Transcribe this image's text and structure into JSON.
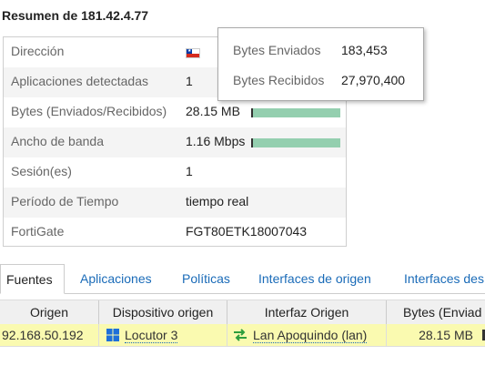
{
  "title": "Resumen de 181.42.4.77",
  "summary": {
    "rows": [
      {
        "label": "Dirección",
        "value": ""
      },
      {
        "label": "Aplicaciones detectadas",
        "value": "1"
      },
      {
        "label": "Bytes (Enviados/Recibidos)",
        "value": "28.15 MB"
      },
      {
        "label": "Ancho de banda",
        "value": "1.16 Mbps"
      },
      {
        "label": "Sesión(es)",
        "value": "1"
      },
      {
        "label": "Período de Tiempo",
        "value": "tiempo real"
      },
      {
        "label": "FortiGate",
        "value": "FGT80ETK18007043"
      }
    ],
    "direction_flag": "chile-flag-icon",
    "bytes_bar_fraction": 1.0,
    "bandwidth_bar_fraction": 1.0
  },
  "tooltip": {
    "sent_label": "Bytes Enviados",
    "sent_value": "183,453",
    "received_label": "Bytes Recibidos",
    "received_value": "27,970,400"
  },
  "tabs": [
    "Fuentes",
    "Aplicaciones",
    "Políticas",
    "Interfaces de origen",
    "Interfaces des"
  ],
  "active_tab": "Fuentes",
  "table": {
    "columns": [
      "Origen",
      "Dispositivo origen",
      "Interfaz Origen",
      "Bytes (Enviad"
    ],
    "rows": [
      {
        "origen": "92.168.50.192",
        "dispositivo": "Locutor 3",
        "interfaz": "Lan Apoquindo (lan)",
        "bytes": "28.15 MB"
      }
    ]
  },
  "colors": {
    "link": "#1a6bb8",
    "bar": "#94cfaf",
    "row_highlight": "#fafab0",
    "windows_icon": "#1e6fd9",
    "interface_icon": "#2e9e3e"
  }
}
